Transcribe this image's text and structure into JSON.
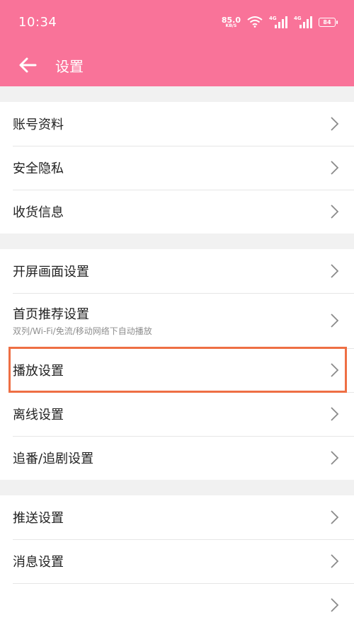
{
  "status_bar": {
    "time": "10:34",
    "net_speed_value": "85.0",
    "net_speed_unit": "KB/S",
    "signal1_label": "4G",
    "signal2_label": "4G",
    "battery": "84"
  },
  "header": {
    "title": "设置",
    "back_icon": "arrow-left-icon",
    "color": "#f97399"
  },
  "groups": [
    {
      "items": [
        {
          "label": "账号资料"
        },
        {
          "label": "安全隐私"
        },
        {
          "label": "收货信息"
        }
      ]
    },
    {
      "items": [
        {
          "label": "开屏画面设置"
        },
        {
          "label": "首页推荐设置",
          "sub": "双列/Wi-Fi/免流/移动网络下自动播放"
        },
        {
          "label": "播放设置"
        },
        {
          "label": "离线设置"
        },
        {
          "label": "追番/追剧设置"
        }
      ]
    },
    {
      "items": [
        {
          "label": "推送设置"
        },
        {
          "label": "消息设置"
        }
      ]
    }
  ],
  "highlight_color": "#ee6f44"
}
